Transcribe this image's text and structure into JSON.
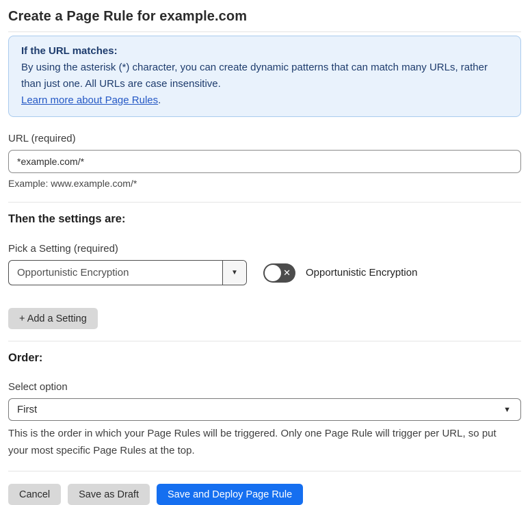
{
  "page": {
    "title": "Create a Page Rule for example.com"
  },
  "info_box": {
    "heading": "If the URL matches:",
    "body": "By using the asterisk (*) character, you can create dynamic patterns that can match many URLs, rather than just one. All URLs are case insensitive.",
    "link_label": "Learn more about Page Rules",
    "link_suffix": "."
  },
  "url_field": {
    "label": "URL (required)",
    "value": "*example.com/*",
    "example": "Example: www.example.com/*"
  },
  "settings_section": {
    "heading": "Then the settings are:",
    "picker_label": "Pick a Setting (required)",
    "picker_value": "Opportunistic Encryption",
    "toggle_state": "off",
    "toggle_label": "Opportunistic Encryption",
    "add_setting_button": "+ Add a Setting"
  },
  "order_section": {
    "heading": "Order:",
    "select_label": "Select option",
    "select_value": "First",
    "help_text": "This is the order in which your Page Rules will be triggered. Only one Page Rule will trigger per URL, so put your most specific Page Rules at the top."
  },
  "footer": {
    "cancel_label": "Cancel",
    "save_draft_label": "Save as Draft",
    "save_deploy_label": "Save and Deploy Page Rule"
  },
  "icons": {
    "caret_down": "▼",
    "toggle_off_x": "✕"
  },
  "colors": {
    "accent_blue": "#156ff0",
    "info_background": "#e9f2fc",
    "info_border": "#aacbee",
    "info_text": "#1e3c6d",
    "link_blue": "#2458c5",
    "toggle_off_background": "#4c4c4c",
    "gray_button_background": "#d8d8d8"
  }
}
